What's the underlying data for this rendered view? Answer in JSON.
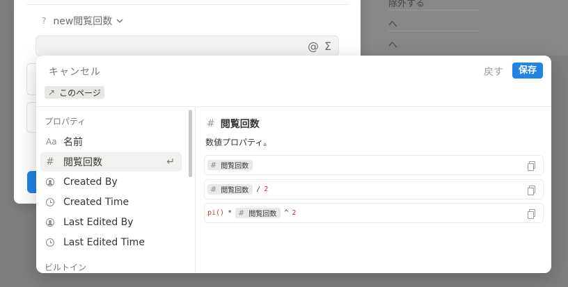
{
  "background": {
    "right_text_1": "除外する",
    "right_text_2": "へ",
    "right_text_3": "へ"
  },
  "behind_dialog": {
    "property_help": "?",
    "property_name": "new閲覧回数",
    "formula_icons": [
      "@",
      "Σ"
    ]
  },
  "dialog": {
    "cancel_label": "キャンセル",
    "back_label": "戻す",
    "save_label": "保存",
    "scope_chip": "このページ",
    "colors": {
      "accent": "#2383e2",
      "number": "#b23b3b"
    }
  },
  "sidebar": {
    "properties_title": "プロパティ",
    "items": [
      {
        "icon": "text-aa-icon",
        "icon_text": "Aa",
        "label": "名前"
      },
      {
        "icon": "number-hash-icon",
        "icon_text": "#",
        "label": "閲覧回数",
        "selected": true,
        "enter_hint": "↵"
      },
      {
        "icon": "person-circle-icon",
        "label": "Created By"
      },
      {
        "icon": "clock-icon",
        "label": "Created Time"
      },
      {
        "icon": "person-circle-icon",
        "label": "Last Edited By"
      },
      {
        "icon": "clock-icon",
        "label": "Last Edited Time"
      }
    ],
    "builtins_title": "ビルトイン"
  },
  "detail": {
    "title_icon": "#",
    "title": "閲覧回数",
    "description": "数値プロパティ。",
    "examples": [
      {
        "token": "閲覧回数"
      },
      {
        "token": "閲覧回数",
        "op": "/",
        "num": "2"
      },
      {
        "prefix": "pi()",
        "prefix_op": "*",
        "token": "閲覧回数",
        "op": "^",
        "num": "2"
      }
    ]
  }
}
